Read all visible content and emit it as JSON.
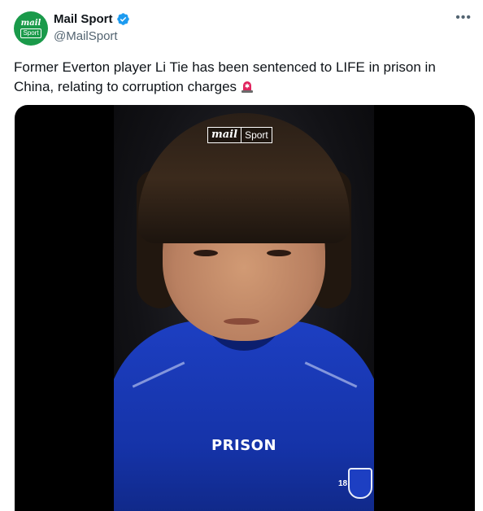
{
  "author": {
    "avatar_line1": "mail",
    "avatar_line2": "Sport",
    "display_name": "Mail Sport",
    "handle": "@MailSport",
    "verified": true
  },
  "tweet": {
    "text": "Former Everton player Li Tie has been sentenced to LIFE in prison in China, relating to corruption charges",
    "emoji": "rotating-light-icon"
  },
  "media": {
    "watermark_mail": "mail",
    "watermark_sport": "Sport",
    "caption": "PRISON",
    "jersey_number": "18"
  },
  "colors": {
    "avatar_bg": "#1a9a4a",
    "verified": "#1d9bf0",
    "handle": "#536471",
    "shirt": "#1d3fc2"
  }
}
